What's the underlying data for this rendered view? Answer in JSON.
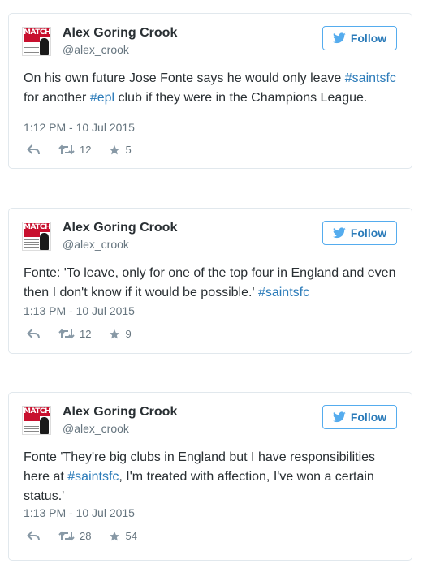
{
  "tweets": [
    {
      "name": "Alex Goring Crook",
      "handle": "@alex_crook",
      "follow_label": "Follow",
      "avatar_text": "MATCH",
      "segments": [
        {
          "t": "On his own future Jose Fonte says he would only leave "
        },
        {
          "t": "#saintsfc",
          "link": true
        },
        {
          "t": " for another "
        },
        {
          "t": "#epl",
          "link": true
        },
        {
          "t": " club if they were in the Champions League."
        }
      ],
      "timestamp": "1:12 PM - 10 Jul 2015",
      "retweets": "12",
      "favorites": "5"
    },
    {
      "name": "Alex Goring Crook",
      "handle": "@alex_crook",
      "follow_label": "Follow",
      "avatar_text": "MATCH",
      "segments": [
        {
          "t": "Fonte: 'To leave, only for one of the top four in England and even then I don't know if it would be possible.' "
        },
        {
          "t": "#saintsfc",
          "link": true
        }
      ],
      "timestamp": "1:13 PM - 10 Jul 2015",
      "retweets": "12",
      "favorites": "9"
    },
    {
      "name": "Alex Goring Crook",
      "handle": "@alex_crook",
      "follow_label": "Follow",
      "avatar_text": "MATCH",
      "segments": [
        {
          "t": "Fonte 'They're big clubs in England but I have responsibilities here at "
        },
        {
          "t": "#saintsfc",
          "link": true
        },
        {
          "t": ", I'm treated with affection, I've won a certain status.'"
        }
      ],
      "timestamp": "1:13 PM - 10 Jul 2015",
      "retweets": "28",
      "favorites": "54"
    }
  ],
  "colors": {
    "link": "#2b7bb9",
    "border": "#e1e8ed",
    "muted": "#66757f",
    "brand_red": "#c8102e"
  },
  "icons": {
    "follow": "bird-icon",
    "reply": "reply-icon",
    "retweet": "retweet-icon",
    "favorite": "star-icon"
  }
}
